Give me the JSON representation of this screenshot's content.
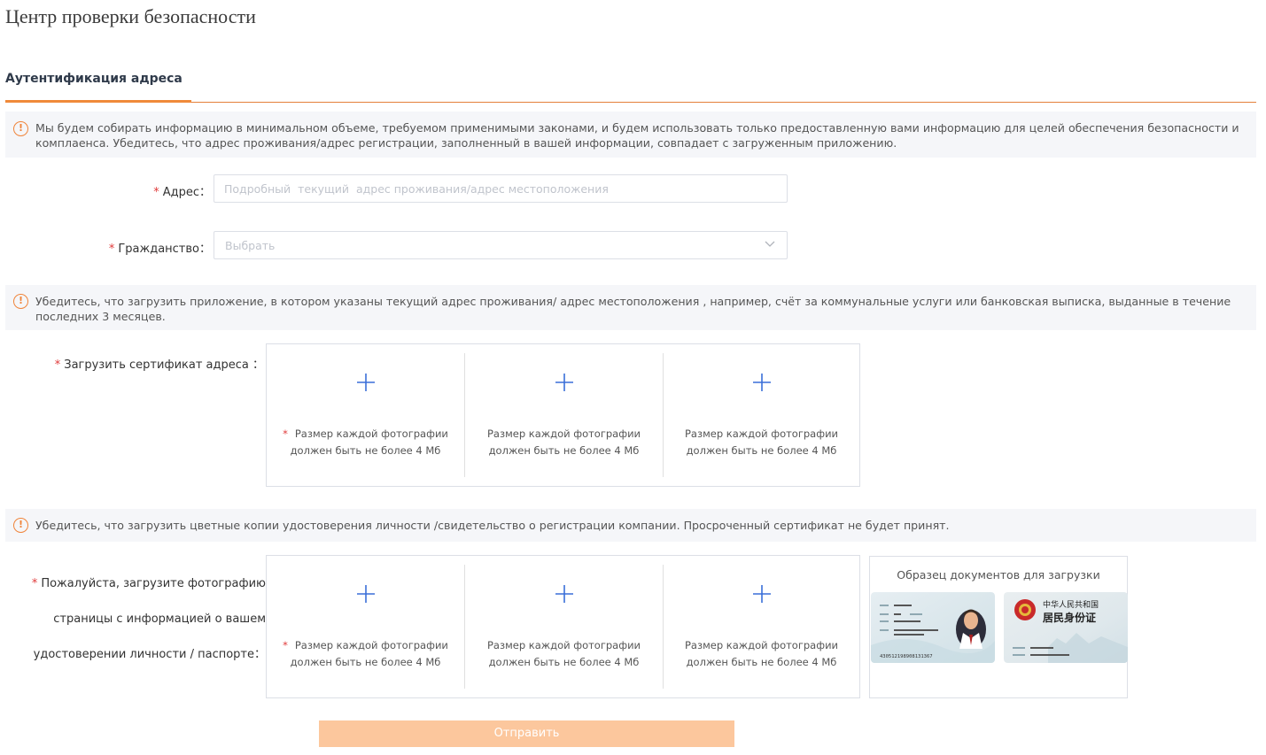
{
  "page": {
    "title": "Центр проверки безопасности"
  },
  "tabs": [
    {
      "label": "Аутентификация адреса"
    }
  ],
  "notices": [
    "Мы будем собирать информацию в минимальном объеме, требуемом применимыми законами, и будем использовать только предоставленную вами информацию для целей обеспечения безопасности и комплаенса. Убедитесь, что адрес проживания/адрес регистрации, заполненный в вашей информации, совпадает с загруженным приложению.",
    "Убедитесь, что загрузить приложение, в котором указаны текущий адрес проживания/ адрес местоположения , например, счёт за коммунальные услуги или банковская выписка, выданные в течение последних 3 месяцев.",
    "Убедитесь, что загрузить цветные копии удостоверения личности /свидетельство о регистрации компании. Просроченный сертификат не будет принят."
  ],
  "form": {
    "required_mark": "*",
    "address": {
      "label": "Адрес：",
      "placeholder": "Подробный  текущий  адрес проживания/адрес местоположения",
      "value": ""
    },
    "citizenship": {
      "label": "Гражданство：",
      "placeholder": "Выбрать"
    },
    "address_certificate": {
      "label": "Загрузить сертификат адреса ：",
      "slots": [
        {
          "required": true,
          "hint": "Размер каждой фотографии должен быть не более 4 Мб"
        },
        {
          "required": false,
          "hint": "Размер каждой фотографии должен быть не более 4 Мб"
        },
        {
          "required": false,
          "hint": "Размер каждой фотографии должен быть не более 4 Мб"
        }
      ]
    },
    "id_document": {
      "label_lines": [
        "Пожалуйста, загрузите фотографию",
        "страницы с информацией о вашем",
        "удостоверении личности / паспорте："
      ],
      "slots": [
        {
          "required": true,
          "hint": "Размер каждой фотографии должен быть не более 4 Мб"
        },
        {
          "required": false,
          "hint": "Размер каждой фотографии должен быть не более 4 Мб"
        },
        {
          "required": false,
          "hint": "Размер каждой фотографии должен быть не более 4 Мб"
        }
      ]
    },
    "sample": {
      "title": "Образец документов для загрузки",
      "front_card": {
        "number": "430512198908131367"
      },
      "back_card": {
        "line1": "中华人民共和国",
        "line2": "居民身份证"
      }
    },
    "submit_label": "Отправить"
  },
  "colors": {
    "accent": "#f08a3a",
    "warning": "#f0843a",
    "required": "#e03a3a",
    "plus": "#3a6fd8",
    "submit_disabled": "#fcc79d"
  }
}
